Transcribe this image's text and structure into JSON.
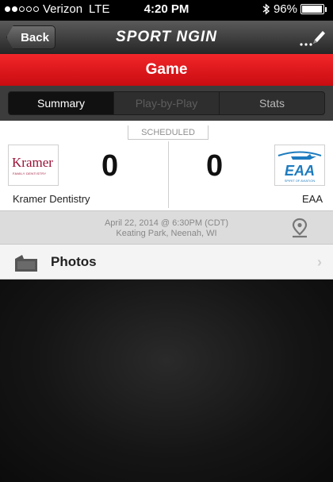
{
  "status_bar": {
    "carrier": "Verizon",
    "network": "LTE",
    "time": "4:20 PM",
    "battery": "96%",
    "battery_level": 0.96,
    "signal_bars": 2
  },
  "navbar": {
    "back_label": "Back",
    "brand": "SPORT NGIN"
  },
  "title": "Game",
  "tabs": [
    {
      "label": "Summary",
      "state": "active"
    },
    {
      "label": "Play-by-Play",
      "state": "disabled"
    },
    {
      "label": "Stats",
      "state": "normal"
    }
  ],
  "game": {
    "status": "SCHEDULED",
    "home": {
      "name": "Kramer Dentistry",
      "score": "0",
      "logo_text": "Kramer",
      "logo_subtext": "FAMILY DENTISTRY"
    },
    "away": {
      "name": "EAA",
      "score": "0",
      "logo_text": "EAA",
      "logo_subtext": "SPIRIT OF AVIATION"
    },
    "date": "April 22, 2014 @ 6:30PM (CDT)",
    "location": "Keating Park, Neenah, WI"
  },
  "photos_label": "Photos",
  "colors": {
    "accent_red": "#e01a1e",
    "kramer_maroon": "#9a1035",
    "eaa_blue": "#1d7bbf"
  },
  "icons": [
    "back-arrow-icon",
    "edit-pencil-icon",
    "map-pin-icon",
    "photos-folder-icon",
    "chevron-right-icon",
    "bluetooth-icon",
    "battery-icon"
  ]
}
